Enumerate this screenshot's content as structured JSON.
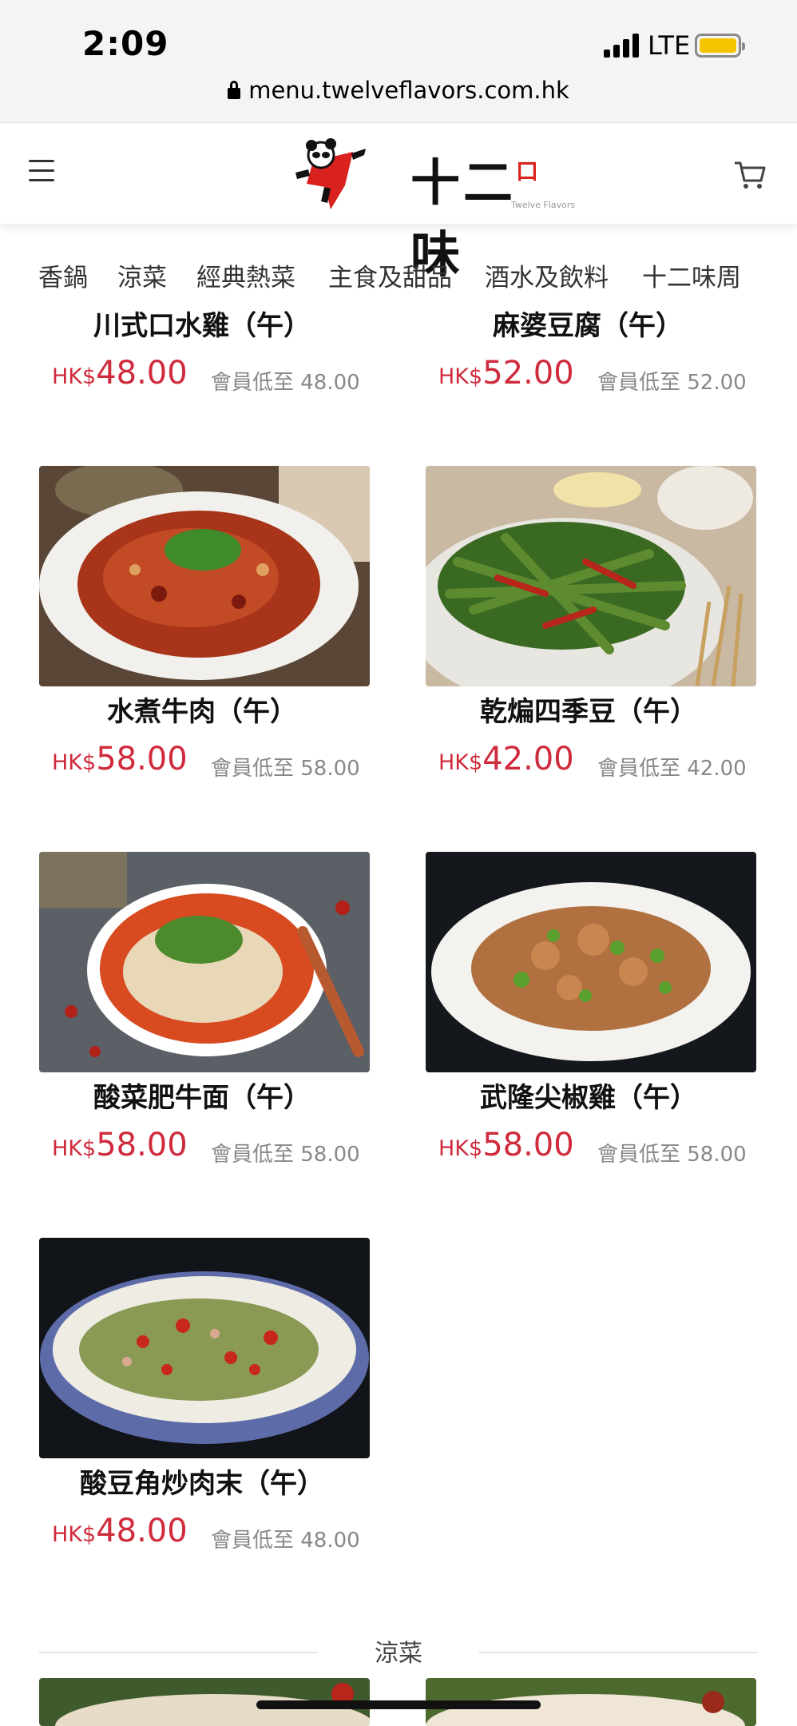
{
  "status_bar": {
    "time": "2:09",
    "network": "LTE"
  },
  "browser": {
    "url": "menu.twelveflavors.com.hk"
  },
  "header": {
    "logo_text_a": "十二",
    "logo_text_b": "味",
    "logo_mark": "口",
    "logo_sub": "Twelve Flavors"
  },
  "tabs": [
    "香鍋",
    "涼菜",
    "經典熱菜",
    "主食及甜品",
    "酒水及飲料",
    "十二味周"
  ],
  "products": [
    {
      "name": "川式口水雞（午）",
      "currency": "HK$",
      "price": "48.00",
      "member_price": "會員低至 48.00"
    },
    {
      "name": "麻婆豆腐（午）",
      "currency": "HK$",
      "price": "52.00",
      "member_price": "會員低至 52.00"
    },
    {
      "name": "水煮牛肉（午）",
      "currency": "HK$",
      "price": "58.00",
      "member_price": "會員低至 58.00"
    },
    {
      "name": "乾煸四季豆（午）",
      "currency": "HK$",
      "price": "42.00",
      "member_price": "會員低至 42.00"
    },
    {
      "name": "酸菜肥牛面（午）",
      "currency": "HK$",
      "price": "58.00",
      "member_price": "會員低至 58.00"
    },
    {
      "name": "武隆尖椒雞（午）",
      "currency": "HK$",
      "price": "58.00",
      "member_price": "會員低至 58.00"
    },
    {
      "name": "酸豆角炒肉末（午）",
      "currency": "HK$",
      "price": "48.00",
      "member_price": "會員低至 48.00"
    }
  ],
  "next_section": {
    "title": "涼菜"
  },
  "colors": {
    "price": "#cf2b3c",
    "battery": "#f5c400",
    "brand_red": "#d9211e"
  },
  "icons": [
    "lock-icon",
    "menu-icon",
    "cart-icon",
    "signal-icon",
    "battery-icon"
  ]
}
